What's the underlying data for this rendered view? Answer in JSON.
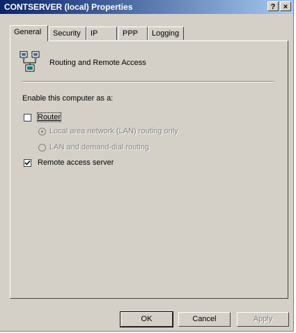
{
  "window": {
    "title": "CONTSERVER (local) Properties",
    "help_label": "?",
    "close_label": "×"
  },
  "tabs": [
    {
      "label": "General"
    },
    {
      "label": "Security"
    },
    {
      "label": "IP"
    },
    {
      "label": "PPP"
    },
    {
      "label": "Logging"
    }
  ],
  "header": {
    "icon": "network-computers-icon",
    "text": "Routing and Remote Access"
  },
  "section": {
    "label": "Enable this computer as a:"
  },
  "router": {
    "label": "Router",
    "checked": false
  },
  "router_options": [
    {
      "label": "Local area network (LAN) routing only",
      "selected": true,
      "disabled": true
    },
    {
      "label": "LAN and demand-dial routing",
      "selected": false,
      "disabled": true
    }
  ],
  "remote_access": {
    "label": "Remote access server",
    "checked": true
  },
  "buttons": {
    "ok": "OK",
    "cancel": "Cancel",
    "apply": "Apply"
  }
}
